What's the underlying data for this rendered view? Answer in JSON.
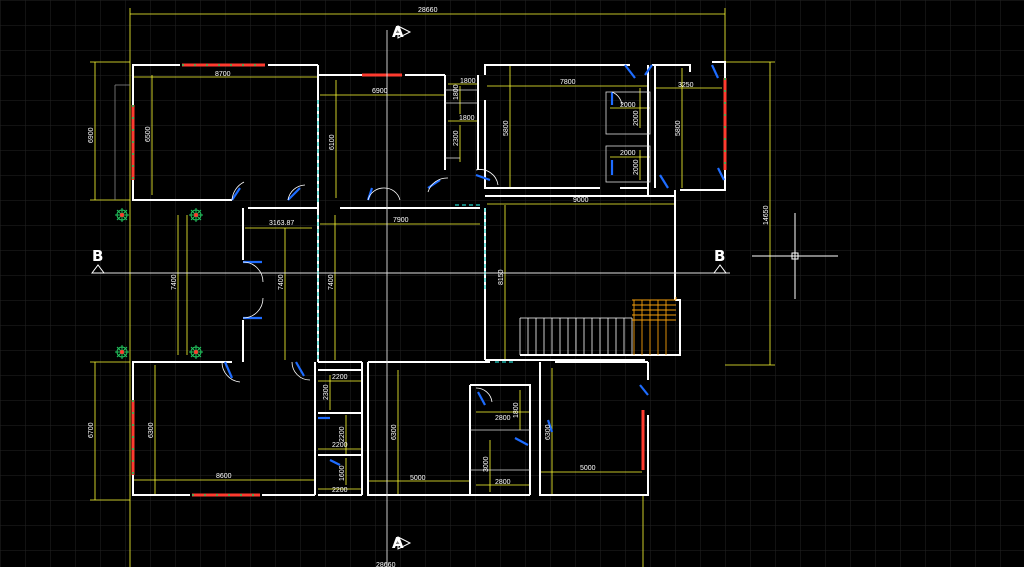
{
  "app": {
    "name": "CAD Drawing Canvas",
    "background": "#000000"
  },
  "colors": {
    "grid": "#222222",
    "wall": "#ffffff",
    "dimension": "#ffff33",
    "window": "#22d3c9",
    "door": "#1e6cff",
    "planter_red": "#ff3b2f",
    "planter_green": "#22c55e",
    "stair_accent": "#f59e0b"
  },
  "section_marks": {
    "a_top": "A",
    "a_bottom": "A",
    "b_left": "B",
    "b_right": "B"
  },
  "dimensions": {
    "overall_top": "28660",
    "overall_bottom": "28660",
    "overall_right": "14650",
    "left_top": "6900",
    "left_bottom": "6700",
    "room_tl_width": "8700",
    "room_tl_height": "6500",
    "corridor_top": "6900",
    "small_a": "1800",
    "small_b": "1800",
    "small_c": "2300",
    "center_height": "6100",
    "room_tm_width": "7800",
    "room_tm_height": "5800",
    "room_tr_width": "3250",
    "room_tr_height": "5800",
    "closet_w1": "2000",
    "closet_h1": "2000",
    "closet_w2": "2000",
    "closet_h2": "2000",
    "hall_width": "7900",
    "stair_width": "9000",
    "stair_height": "8150",
    "porch_width": "3163.87",
    "porch_h1": "7400",
    "porch_h2": "7400",
    "porch_h3": "7400",
    "room_bl_width": "8600",
    "room_bl_height": "6300",
    "bath_w1": "2200",
    "bath_h1": "2300",
    "bath_w2": "2200",
    "bath_h2": "2200",
    "bath_w3": "2200",
    "bath_h3": "1600",
    "room_bm_width": "5000",
    "room_bm_height": "6300",
    "wc_w1": "2800",
    "wc_h1": "1800",
    "wc_w2": "2800",
    "wc_h2": "3000",
    "room_br_width": "5000",
    "room_br_height": "6300"
  }
}
